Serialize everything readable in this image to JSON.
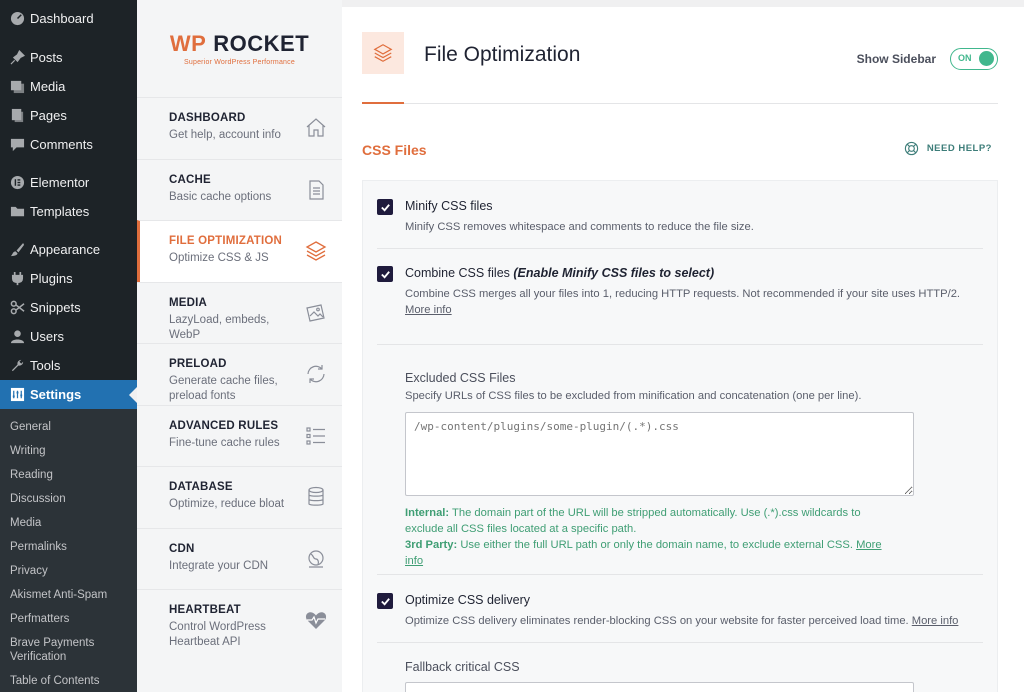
{
  "wp_menu": {
    "items": [
      {
        "label": "Dashboard",
        "icon": "dashboard-icon"
      },
      {
        "label": "Posts",
        "icon": "pin-icon"
      },
      {
        "label": "Media",
        "icon": "media-icon"
      },
      {
        "label": "Pages",
        "icon": "pages-icon"
      },
      {
        "label": "Comments",
        "icon": "comments-icon"
      },
      {
        "label": "Elementor",
        "icon": "elementor-icon"
      },
      {
        "label": "Templates",
        "icon": "folder-icon"
      },
      {
        "label": "Appearance",
        "icon": "brush-icon"
      },
      {
        "label": "Plugins",
        "icon": "plug-icon"
      },
      {
        "label": "Snippets",
        "icon": "scissors-icon"
      },
      {
        "label": "Users",
        "icon": "user-icon"
      },
      {
        "label": "Tools",
        "icon": "wrench-icon"
      },
      {
        "label": "Settings",
        "icon": "settings-icon"
      }
    ],
    "settings_submenu": [
      "General",
      "Writing",
      "Reading",
      "Discussion",
      "Media",
      "Permalinks",
      "Privacy",
      "Akismet Anti-Spam",
      "Perfmatters",
      "Brave Payments Verification",
      "Table of Contents"
    ]
  },
  "rocket": {
    "logo_wp": "WP",
    "logo_rocket": "ROCKET",
    "logo_tagline": "Superior WordPress Performance",
    "nav": [
      {
        "title": "DASHBOARD",
        "desc": "Get help, account info",
        "icon": "home-icon"
      },
      {
        "title": "CACHE",
        "desc": "Basic cache options",
        "icon": "document-icon"
      },
      {
        "title": "FILE OPTIMIZATION",
        "desc": "Optimize CSS & JS",
        "icon": "layers-icon"
      },
      {
        "title": "MEDIA",
        "desc": "LazyLoad, embeds, WebP",
        "icon": "images-icon"
      },
      {
        "title": "PRELOAD",
        "desc": "Generate cache files, preload fonts",
        "icon": "refresh-icon"
      },
      {
        "title": "ADVANCED RULES",
        "desc": "Fine-tune cache rules",
        "icon": "list-icon"
      },
      {
        "title": "DATABASE",
        "desc": "Optimize, reduce bloat",
        "icon": "database-icon"
      },
      {
        "title": "CDN",
        "desc": "Integrate your CDN",
        "icon": "globe-icon"
      },
      {
        "title": "HEARTBEAT",
        "desc": "Control WordPress Heartbeat API",
        "icon": "heartbeat-icon"
      }
    ]
  },
  "main": {
    "title": "File Optimization",
    "show_sidebar_label": "Show Sidebar",
    "toggle_text": "ON",
    "section_title": "CSS Files",
    "need_help": "NEED HELP?",
    "minify": {
      "label": "Minify CSS files",
      "desc": "Minify CSS removes whitespace and comments to reduce the file size."
    },
    "combine": {
      "label": "Combine CSS files",
      "label_note": "(Enable Minify CSS files to select)",
      "desc": "Combine CSS merges all your files into 1, reducing HTTP requests. Not recommended if your site uses HTTP/2.",
      "more_info": "More info"
    },
    "excluded": {
      "title": "Excluded CSS Files",
      "desc": "Specify URLs of CSS files to be excluded from minification and concatenation (one per line).",
      "placeholder": "/wp-content/plugins/some-plugin/(.*).css",
      "internal_label": "Internal:",
      "internal_text": "The domain part of the URL will be stripped automatically. Use (.*).css wildcards to exclude all CSS files located at a specific path.",
      "third_label": "3rd Party:",
      "third_text": "Use either the full URL path or only the domain name, to exclude external CSS.",
      "third_more": "More info"
    },
    "optimize": {
      "label": "Optimize CSS delivery",
      "desc": "Optimize CSS delivery eliminates render-blocking CSS on your website for faster perceived load time.",
      "more_info": "More info"
    },
    "fallback": {
      "title": "Fallback critical CSS"
    }
  },
  "colors": {
    "accent": "#e06e3d",
    "toggle": "#40b78d",
    "wp_active": "#2271b1"
  }
}
